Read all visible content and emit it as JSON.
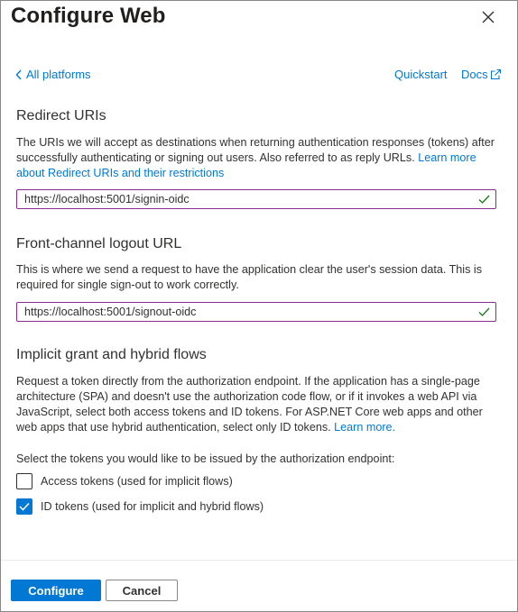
{
  "panel": {
    "title": "Configure Web",
    "close_icon": "close-icon"
  },
  "nav": {
    "back_label": "All platforms",
    "quickstart_label": "Quickstart",
    "docs_label": "Docs"
  },
  "redirect": {
    "title": "Redirect URIs",
    "description": "The URIs we will accept as destinations when returning authentication responses (tokens) after successfully authenticating or signing out users. Also referred to as reply URLs.",
    "link": "Learn more about Redirect URIs and their restrictions",
    "value": "https://localhost:5001/signin-oidc"
  },
  "logout": {
    "title": "Front-channel logout URL",
    "description": "This is where we send a request to have the application clear the user's session data. This is required for single sign-out to work correctly.",
    "value": "https://localhost:5001/signout-oidc"
  },
  "implicit": {
    "title": "Implicit grant and hybrid flows",
    "description": "Request a token directly from the authorization endpoint. If the application has a single-page architecture (SPA) and doesn't use the authorization code flow, or if it invokes a web API via JavaScript, select both access tokens and ID tokens. For ASP.NET Core web apps and other web apps that use hybrid authentication, select only ID tokens.",
    "link": "Learn more.",
    "prompt": "Select the tokens you would like to be issued by the authorization endpoint:",
    "options": [
      {
        "label": "Access tokens (used for implicit flows)",
        "checked": false
      },
      {
        "label": "ID tokens (used for implicit and hybrid flows)",
        "checked": true
      }
    ]
  },
  "footer": {
    "configure_label": "Configure",
    "cancel_label": "Cancel"
  },
  "colors": {
    "accent": "#0078d4",
    "input_border": "#8a2c8f",
    "valid_check": "#107c10"
  }
}
